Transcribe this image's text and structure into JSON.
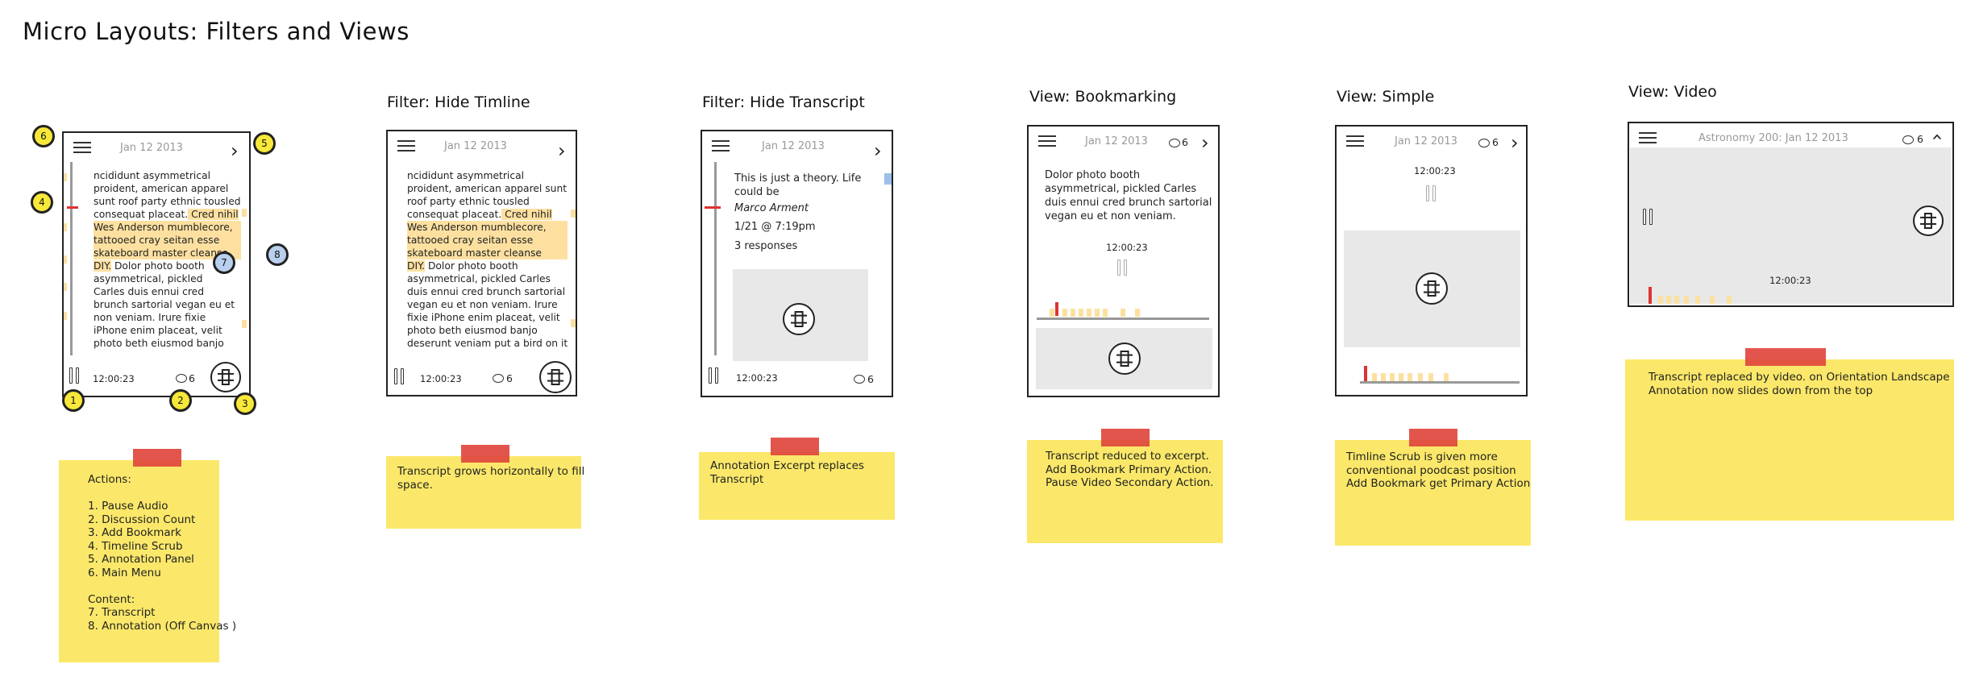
{
  "page_title": "Micro Layouts: Filters and Views",
  "sections": {
    "hide_timeline": "Filter: Hide Timline",
    "hide_transcript": "Filter: Hide Transcript",
    "bookmarking": "View: Bookmarking",
    "simple": "View: Simple",
    "video": "View: Video"
  },
  "date": "Jan 12 2013",
  "video_date": "Astronomy 200: Jan 12 2013",
  "time": "12:00:23",
  "discussion_count": "6",
  "transcript": {
    "line1": "ncididunt asymmetrical",
    "line2": "proident, american apparel",
    "line3": "sunt roof party ethnic tousled",
    "line4a": "consequat placeat.",
    "line4b": " Cred nihil",
    "line5": "Wes Anderson mumblecore,",
    "line6": "tattooed cray seitan esse",
    "line7": "skateboard master cleanse",
    "line8a": "DIY.",
    "line8b": " Dolor photo booth",
    "line9": "asymmetrical, pickled",
    "line10": "Carles duis ennui cred",
    "line11": "brunch sartorial vegan eu et",
    "line12": "non veniam. Irure fixie",
    "line13": "iPhone enim placeat, velit",
    "line14": "photo beth eiusmod banjo"
  },
  "transcript2": {
    "line1": "ncididunt asymmetrical",
    "line2": "proident, american apparel sunt",
    "line3": "roof party ethnic tousled",
    "line4a": "consequat placeat.",
    "line4b": " Cred nihil",
    "line5": "Wes Anderson mumblecore,",
    "line6": "tattooed cray seitan esse",
    "line7": "skateboard master cleanse",
    "line8a": "DIY.",
    "line8b": " Dolor photo booth",
    "line9": "asymmetrical, pickled Carles",
    "line10": "duis ennui cred brunch sartorial",
    "line11": "vegan eu et non veniam. Irure",
    "line12": "fixie iPhone enim placeat, velit",
    "line13": "photo beth eiusmod banjo",
    "line14": "deserunt veniam put a bird on it"
  },
  "annotation": {
    "line1": "This is just a theory. Life",
    "line2": "could be",
    "author": "Marco Arment",
    "datetime": "1/21 @ 7:19pm",
    "responses": "3 responses"
  },
  "excerpt": {
    "line1": "Dolor photo booth",
    "line2": "asymmetrical, pickled Carles",
    "line3": "duis ennui cred brunch sartorial",
    "line4": "vegan eu et non veniam."
  },
  "callouts": [
    "1",
    "2",
    "3",
    "4",
    "5",
    "6",
    "7",
    "8"
  ],
  "notes": {
    "actions": "Actions:\n\n1. Pause Audio\n2. Discussion Count\n3. Add Bookmark\n4. Timeline Scrub\n5. Annotation Panel\n6. Main Menu\n\nContent:\n7. Transcript\n8. Annotation (Off Canvas )",
    "hide_timeline": "Transcript grows horizontally to fill\nspace.",
    "hide_transcript": "Annotation Excerpt replaces\nTranscript",
    "bookmarking": "Transcript reduced to excerpt.\nAdd Bookmark Primary Action.\nPause Video Secondary Action.",
    "simple": "Timline Scrub is given more\nconventional poodcast position\nAdd Bookmark get Primary Action",
    "video": "Transcript replaced by video. on Orientation Landscape\nAnnotation now slides down from the top"
  },
  "colors": {
    "highlight": "#fde0a0",
    "sticky": "#fbe86a",
    "tape": "#e0473e",
    "callout": "#f7e83a",
    "annotation_callout": "#b9cfee"
  }
}
